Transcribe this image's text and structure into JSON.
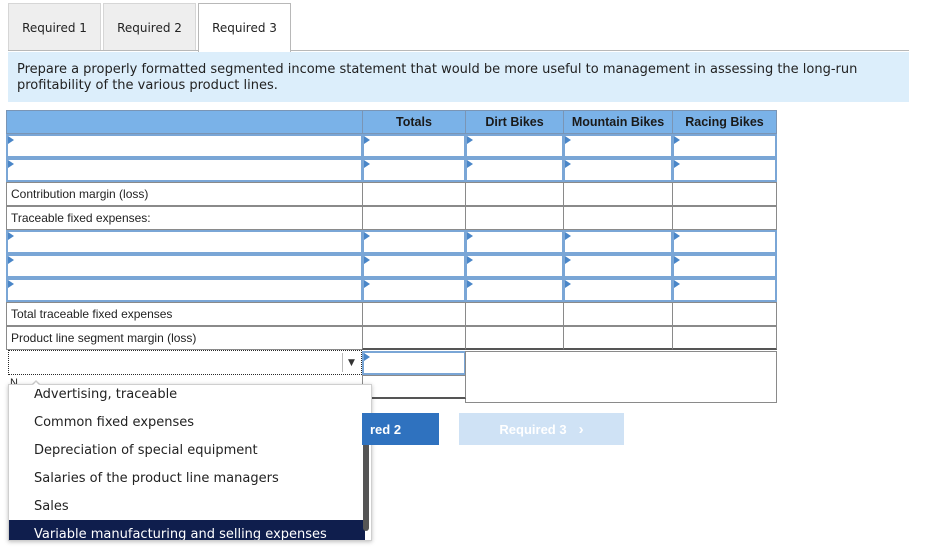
{
  "tabs": [
    {
      "label": "Required 1"
    },
    {
      "label": "Required 2"
    },
    {
      "label": "Required 3"
    }
  ],
  "instruction": "Prepare a properly formatted segmented income statement that would be more useful to management in assessing the long-run profitability of the various product lines.",
  "table": {
    "headers": [
      "",
      "Totals",
      "Dirt Bikes",
      "Mountain Bikes",
      "Racing Bikes"
    ],
    "labels": {
      "contribution_margin": "Contribution margin (loss)",
      "traceable_fixed": "Traceable fixed expenses:",
      "total_traceable": "Total traceable fixed expenses",
      "segment_margin": "Product line segment margin (loss)"
    }
  },
  "dropdown": {
    "partial_label": "N",
    "options": [
      "Advertising, traceable",
      "Common fixed expenses",
      "Depreciation of special equipment",
      "Salaries of the product line managers",
      "Sales",
      "Variable manufacturing and selling expenses"
    ],
    "selected_index": 5
  },
  "nav": {
    "prev_label": "red 2",
    "next_label": "Required 3",
    "next_arrow": "›"
  },
  "colors": {
    "header_blue": "#7ab2e8",
    "instruction_bg": "#dceefb",
    "prev_button": "#2f72bf",
    "next_button_disabled": "#cfe2f5",
    "selected_option": "#0f1e4d"
  }
}
